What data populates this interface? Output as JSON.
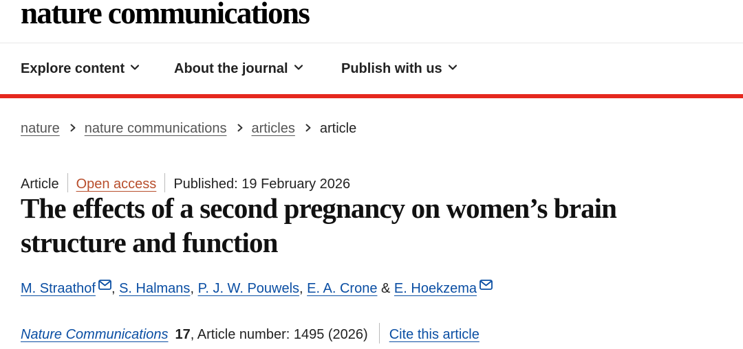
{
  "header": {
    "brand": "nature communications",
    "nav": [
      {
        "label": "Explore content"
      },
      {
        "label": "About the journal"
      },
      {
        "label": "Publish with us"
      }
    ]
  },
  "breadcrumb": {
    "items": [
      "nature",
      "nature communications",
      "articles"
    ],
    "current": "article"
  },
  "article": {
    "type": "Article",
    "access": "Open access",
    "published": "Published: 19 February 2026",
    "title": "The effects of a second pregnancy on women’s brain structure and function",
    "authors": [
      "M. Straathof",
      "S. Halmans",
      "P. J. W. Pouwels",
      "E. A. Crone",
      "E. Hoekzema"
    ],
    "author_separator": ", ",
    "author_and": "&",
    "journal": "Nature Communications",
    "volume": "17",
    "article_number_text": ", Article number: 1495 (2026)",
    "cite_label": "Cite this article"
  },
  "icons": {
    "nav_chevron": "chevron-down-icon",
    "breadcrumb_separator": "chevron-right-icon",
    "corresponding_author": "mail-icon"
  },
  "colors": {
    "accent_red": "#e5281e",
    "link_blue": "#0a4ea3",
    "open_access": "#b84e2c"
  }
}
